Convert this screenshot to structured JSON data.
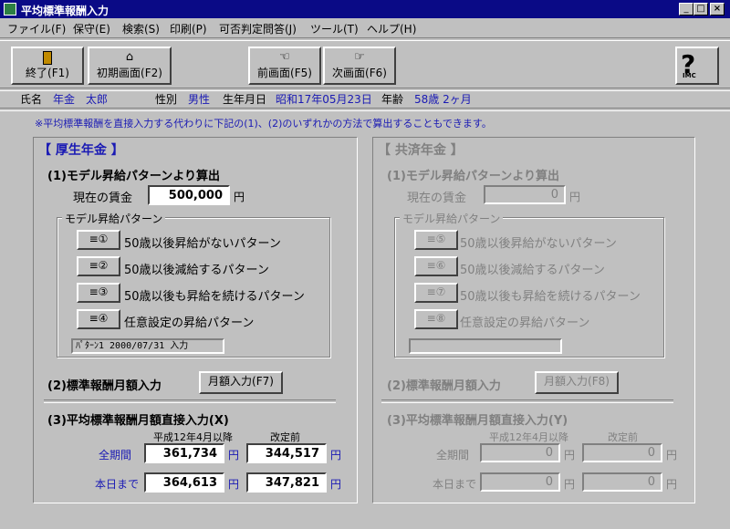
{
  "window": {
    "title": "平均標準報酬入力"
  },
  "menu": [
    "ファイル(F)",
    "保守(E)",
    "検索(S)",
    "印刷(P)",
    "可否判定問答(J)",
    "ツール(T)",
    "ヘルプ(H)"
  ],
  "toolbar": {
    "exit": "終了(F1)",
    "home": "初期画面(F2)",
    "prev": "前画面(F5)",
    "next": "次画面(F6)",
    "help_logo": "IMC"
  },
  "person": {
    "name_label": "氏名",
    "name": "年金　太郎",
    "sex_label": "性別",
    "sex": "男性",
    "dob_label": "生年月日",
    "dob": "昭和17年05月23日",
    "age_label": "年齢",
    "age": "58歳 2ヶ月"
  },
  "notice": "※平均標準報酬を直接入力する代わりに下記の(1)、(2)のいずれかの方法で算出することもできます。",
  "kosei": {
    "title": "【 厚生年金 】",
    "s1_title": "(1)モデル昇給パターンより算出",
    "wage_label": "現在の賃金",
    "wage": "500,000",
    "yen": "円",
    "pattern_group": "モデル昇給パターン",
    "patterns": [
      {
        "num": "①",
        "label": "50歳以後昇給がないパターン"
      },
      {
        "num": "②",
        "label": "50歳以後減給するパターン"
      },
      {
        "num": "③",
        "label": "50歳以後も昇給を続けるパターン"
      },
      {
        "num": "④",
        "label": "任意設定の昇給パターン"
      }
    ],
    "status": "ﾊﾟﾀｰﾝ1 2000/07/31 入力",
    "s2_title": "(2)標準報酬月額入力",
    "s2_button": "月額入力(F7)",
    "s3_title": "(3)平均標準報酬月額直接入力(X)",
    "col1": "平成12年4月以降",
    "col2": "改定前",
    "row1_label": "全期間",
    "row2_label": "本日まで",
    "row1": [
      "361,734",
      "344,517"
    ],
    "row2": [
      "364,613",
      "347,821"
    ]
  },
  "kyosai": {
    "title": "【 共済年金 】",
    "s1_title": "(1)モデル昇給パターンより算出",
    "wage_label": "現在の賃金",
    "wage": "0",
    "yen": "円",
    "pattern_group": "モデル昇給パターン",
    "patterns": [
      {
        "num": "⑤",
        "label": "50歳以後昇給がないパターン"
      },
      {
        "num": "⑥",
        "label": "50歳以後減給するパターン"
      },
      {
        "num": "⑦",
        "label": "50歳以後も昇給を続けるパターン"
      },
      {
        "num": "⑧",
        "label": "任意設定の昇給パターン"
      }
    ],
    "status": "",
    "s2_title": "(2)標準報酬月額入力",
    "s2_button": "月額入力(F8)",
    "s3_title": "(3)平均標準報酬月額直接入力(Y)",
    "col1": "平成12年4月以降",
    "col2": "改定前",
    "row1_label": "全期間",
    "row2_label": "本日まで",
    "row1": [
      "0",
      "0"
    ],
    "row2": [
      "0",
      "0"
    ]
  }
}
